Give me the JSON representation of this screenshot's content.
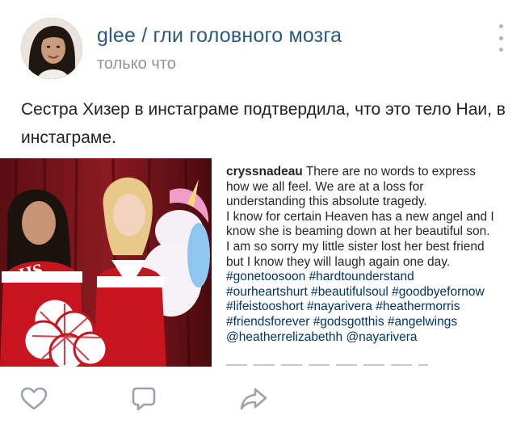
{
  "post": {
    "group_name": "glee / гли головного мозга",
    "timestamp": "только что",
    "text": "Сестра Хизер в инстаграме подтвердила, что это тело Наи, в инстаграме.",
    "attachment": {
      "caption_user": "cryssnadeau",
      "caption_lines": [
        "There are no words to express",
        "how we all feel. We are at a loss for",
        "understanding this absolute tragedy.",
        "I know for certain Heaven has a new angel and I",
        "know she is beaming down at her beautiful son.",
        "I am so sorry my little sister lost her best friend",
        "but I know they will laugh again one day."
      ],
      "hashtag_lines": [
        "#gonetoosoon #hardtounderstand",
        "#ourheartshurt #beautifulsoul #goodbyefornow",
        "#lifeistooshort #nayarivera #heathermorris",
        "#friendsforever #godsgotthis #angelwings",
        "@heatherrelizabethh @nayarivera"
      ],
      "photo_text": "HS"
    },
    "actions": {
      "like_icon": "heart-icon",
      "comment_icon": "comment-icon",
      "share_icon": "share-icon"
    }
  },
  "colors": {
    "group_link": "#2a5885",
    "muted": "#939393",
    "icon": "#99a2ad",
    "hashtag": "#003569"
  }
}
